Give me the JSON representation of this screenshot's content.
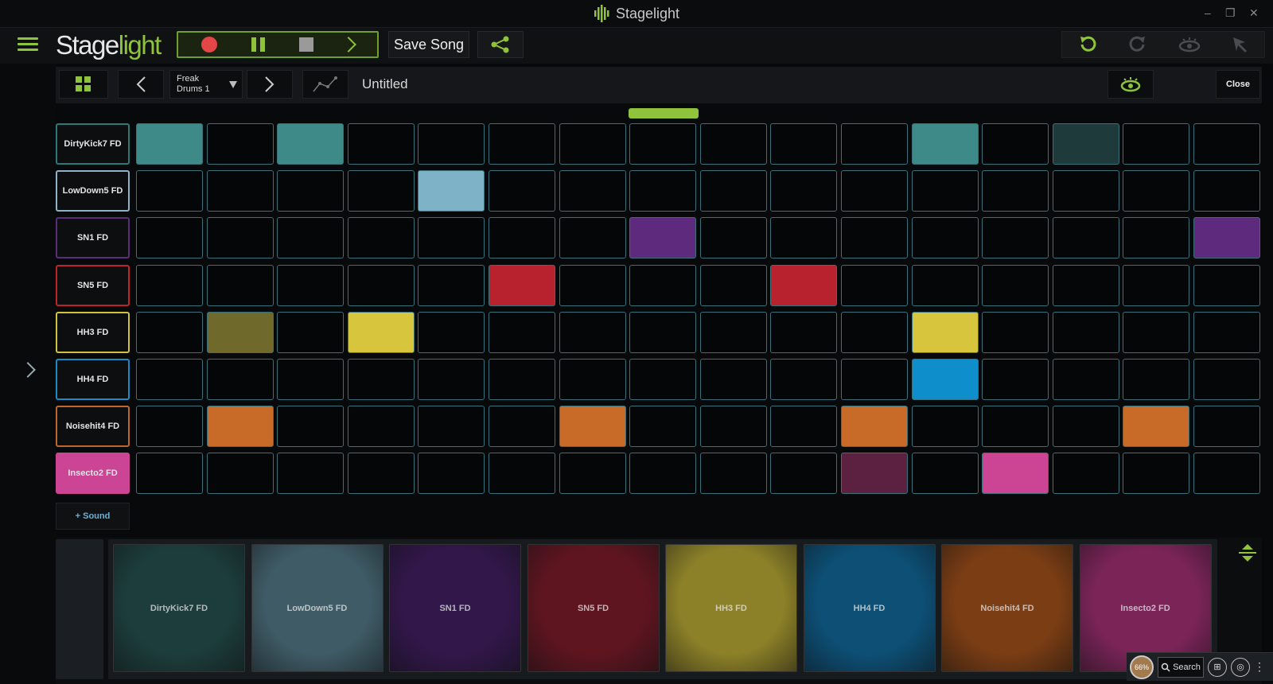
{
  "window": {
    "title": "Stagelight",
    "controls": [
      "–",
      "❐",
      "✕"
    ]
  },
  "toolbar": {
    "logo_main": "Stage",
    "logo_accent": "light",
    "save_label": "Save Song",
    "record_icon": "record-icon",
    "pause_icon": "pause-icon",
    "stop_icon": "stop-icon",
    "play_icon": "play-icon",
    "share_icon": "share-icon",
    "undo_icon": "undo-icon",
    "redo_icon": "redo-icon",
    "view_icon": "eye-icon",
    "pointer_icon": "pointer-icon"
  },
  "clipbar": {
    "kit_line1": "Freak",
    "kit_line2": "Drums 1",
    "title": "Untitled",
    "close_label": "Close"
  },
  "add_sound_label": "+ Sound",
  "colors": {
    "accent": "#8fc33b",
    "cell_border": "#3b6f7a"
  },
  "tracks": [
    {
      "name": "DirtyKick7 FD",
      "color": "#3d8a88",
      "dim": "#1e3a3a",
      "active": [
        0,
        2,
        11
      ],
      "dimmed": [
        13
      ]
    },
    {
      "name": "LowDown5 FD",
      "color": "#7eb2c6",
      "dim": "#2b4048",
      "active": [
        4
      ],
      "dimmed": []
    },
    {
      "name": "SN1 FD",
      "color": "#5e2a7e",
      "dim": "#2a1538",
      "active": [
        7,
        15
      ],
      "dimmed": []
    },
    {
      "name": "SN5 FD",
      "color": "#b8222e",
      "dim": "#4a1216",
      "active": [
        5,
        9
      ],
      "dimmed": []
    },
    {
      "name": "HH3 FD",
      "color": "#d8c53e",
      "dim": "#6f6a2c",
      "active": [
        3,
        11
      ],
      "dimmed": [
        1
      ]
    },
    {
      "name": "HH4 FD",
      "color": "#0e8ecb",
      "dim": "#0d3a55",
      "active": [
        11
      ],
      "dimmed": []
    },
    {
      "name": "Noisehit4 FD",
      "color": "#c86a28",
      "dim": "#4e2a12",
      "active": [
        1,
        6,
        10,
        14
      ],
      "dimmed": []
    },
    {
      "name": "Insecto2 FD",
      "color": "#cc4494",
      "dim": "#5c2040",
      "active": [
        12
      ],
      "dimmed": [
        10
      ]
    }
  ],
  "label_borders": [
    "#2c7a78",
    "#8fb2c8",
    "#5a2c7a",
    "#c0232b",
    "#d2c23a",
    "#1c8ac4",
    "#c0662a",
    "#cc4494"
  ],
  "pads": [
    {
      "label": "DirtyKick7 FD",
      "bg": "#1c3d3b"
    },
    {
      "label": "LowDown5 FD",
      "bg": "#3f5b66"
    },
    {
      "label": "SN1 FD",
      "bg": "#32174a"
    },
    {
      "label": "SN5 FD",
      "bg": "#5e1520"
    },
    {
      "label": "HH3 FD",
      "bg": "#8c8028"
    },
    {
      "label": "HH4 FD",
      "bg": "#0d4f75"
    },
    {
      "label": "Noisehit4 FD",
      "bg": "#7a3d14"
    },
    {
      "label": "Insecto2 FD",
      "bg": "#7a2458"
    }
  ],
  "taskbar": {
    "percent": "66%",
    "search_label": "Search"
  }
}
